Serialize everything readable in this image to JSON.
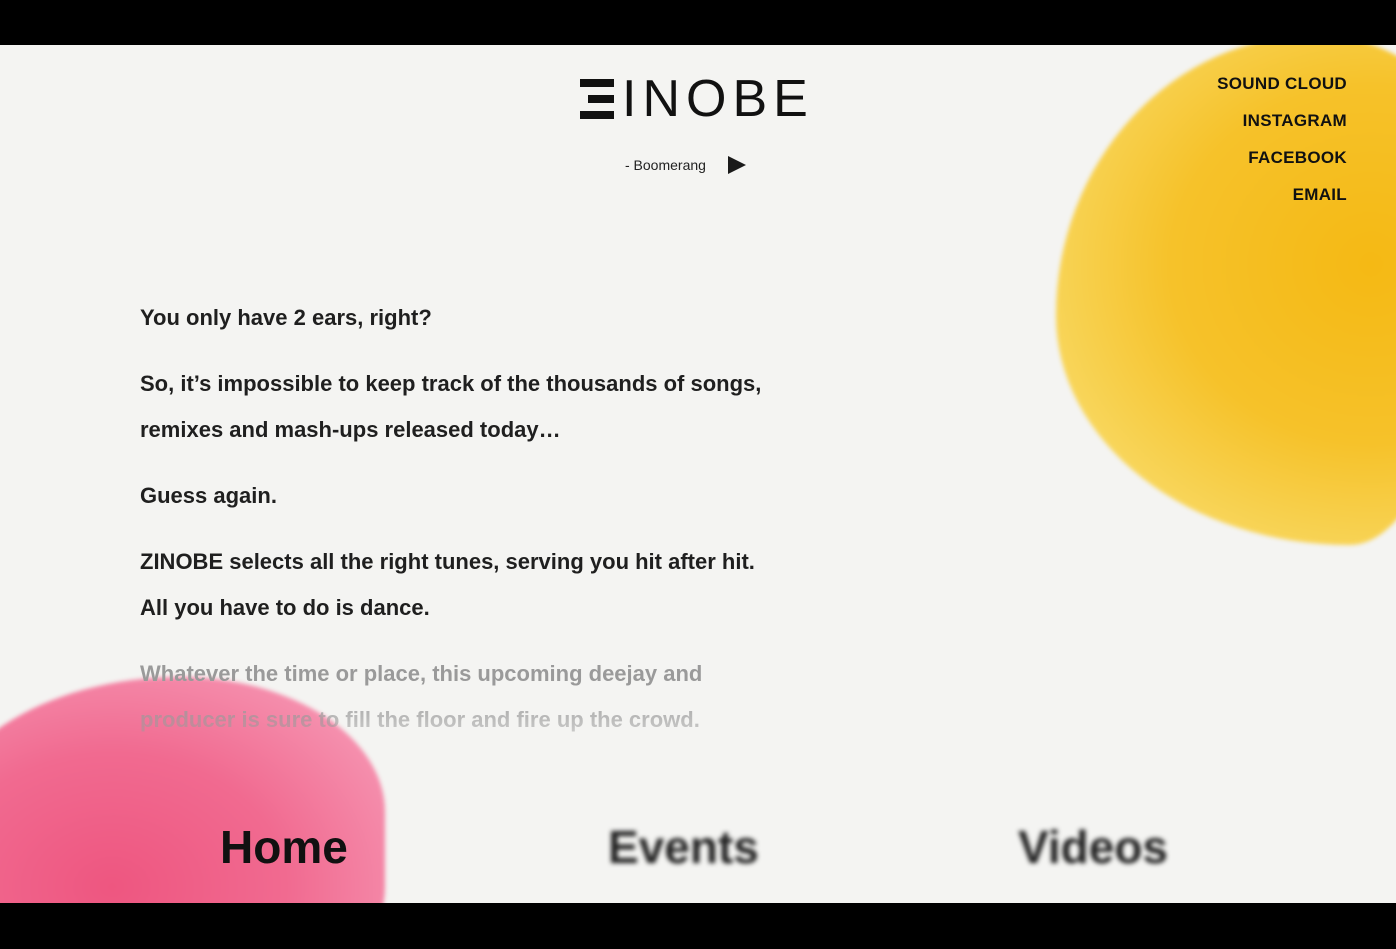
{
  "brand": {
    "logo_text": "INOBE",
    "logo_full": "ZINOBE"
  },
  "player": {
    "track_title": "- Boomerang",
    "play_icon": "play-icon"
  },
  "social_links": [
    {
      "label": "SOUND CLOUD"
    },
    {
      "label": "INSTAGRAM"
    },
    {
      "label": "FACEBOOK"
    },
    {
      "label": "EMAIL"
    }
  ],
  "about": {
    "p1": "You only have 2 ears, right?",
    "p2_line1": "So, it’s impossible to keep track of the thousands of songs,",
    "p2_line2": "remixes and mash-ups released today…",
    "p3": "Guess again.",
    "p4_line1": "ZINOBE selects all the right tunes, serving you hit after hit.",
    "p4_line2": "All you have to do is dance.",
    "p5_line1": "Whatever the time or place, this upcoming deejay and",
    "p5_line2": "producer is sure to fill the floor and fire up the crowd."
  },
  "nav": {
    "home": "Home",
    "events": "Events",
    "videos": "Videos"
  },
  "colors": {
    "background": "#f4f4f2",
    "accent_yellow": "#f5b914",
    "accent_pink": "#ee5680",
    "text": "#1f1f1f"
  }
}
